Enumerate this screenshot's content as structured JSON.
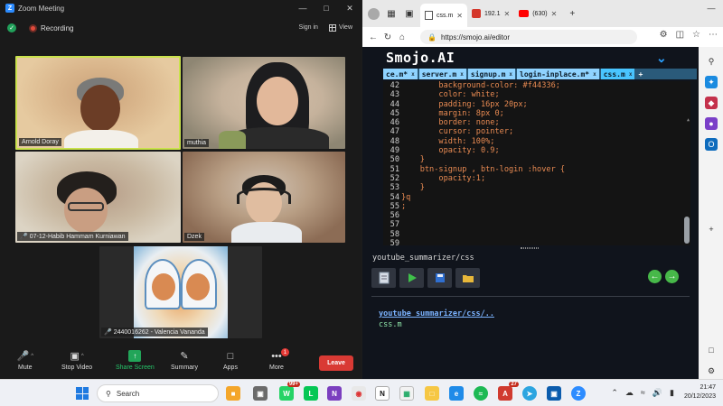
{
  "zoom": {
    "title": "Zoom Meeting",
    "recording_label": "Recording",
    "sign_in": "Sign in",
    "view": "View",
    "participants": [
      {
        "name": "Arnold Doray",
        "muted": false
      },
      {
        "name": "muthia",
        "muted": false
      },
      {
        "name": "07-12-Habib Hammam Kurniawan",
        "muted": true
      },
      {
        "name": "Dzek",
        "muted": false
      },
      {
        "name": "2440016262 - Valencia Vananda",
        "muted": true
      }
    ],
    "toolbar": {
      "mute": "Mute",
      "stop_video": "Stop Video",
      "share_screen": "Share Screen",
      "summary": "Summary",
      "apps": "Apps",
      "more": "More",
      "more_badge": "1",
      "leave": "Leave"
    }
  },
  "browser": {
    "tabs": [
      {
        "label": "css.m",
        "active": true
      },
      {
        "label": "192.1",
        "active": false
      },
      {
        "label": "(630)",
        "active": false
      }
    ],
    "url": "https://smojo.ai/editor"
  },
  "smojo": {
    "logo": "Smojo.AI",
    "file_tabs": [
      "ce.m*",
      "server.m",
      "signup.m",
      "login-inplace.m*",
      "css.m"
    ],
    "active_file": "css.m",
    "more_tabs": "+",
    "code_lines": [
      {
        "n": "42",
        "text": "        background-color: #f44336;"
      },
      {
        "n": "43",
        "text": "        color: white;"
      },
      {
        "n": "44",
        "text": "        padding: 16px 20px;"
      },
      {
        "n": "45",
        "text": "        margin: 8px 0;"
      },
      {
        "n": "46",
        "text": "        border: none;"
      },
      {
        "n": "47",
        "text": "        cursor: pointer;"
      },
      {
        "n": "48",
        "text": "        width: 100%;"
      },
      {
        "n": "49",
        "text": "        opacity: 0.9;"
      },
      {
        "n": "50",
        "text": "    }"
      },
      {
        "n": "51",
        "text": "    btn-signup , btn-login :hover {"
      },
      {
        "n": "52",
        "text": "        opacity:1;"
      },
      {
        "n": "53",
        "text": "    }"
      },
      {
        "n": "54",
        "text": "}q"
      },
      {
        "n": "55",
        "text": ";"
      },
      {
        "n": "56",
        "text": ""
      },
      {
        "n": "57",
        "text": ""
      },
      {
        "n": "58",
        "text": ""
      },
      {
        "n": "59",
        "text": ""
      }
    ],
    "path": "youtube_summarizer/css",
    "dir_link": "youtube_summarizer/css/..",
    "dir_file": "css.m"
  },
  "taskbar": {
    "search": "Search",
    "whatsapp_badge": "99+",
    "app_badge": "27",
    "time": "21:47",
    "date": "20/12/2023"
  },
  "colors": {
    "zoom_share_green": "#22a559",
    "leave_red": "#d93a34",
    "active_speaker_border": "#c9e24c",
    "code_text": "#e88a52",
    "smojo_bg": "#10141c"
  }
}
